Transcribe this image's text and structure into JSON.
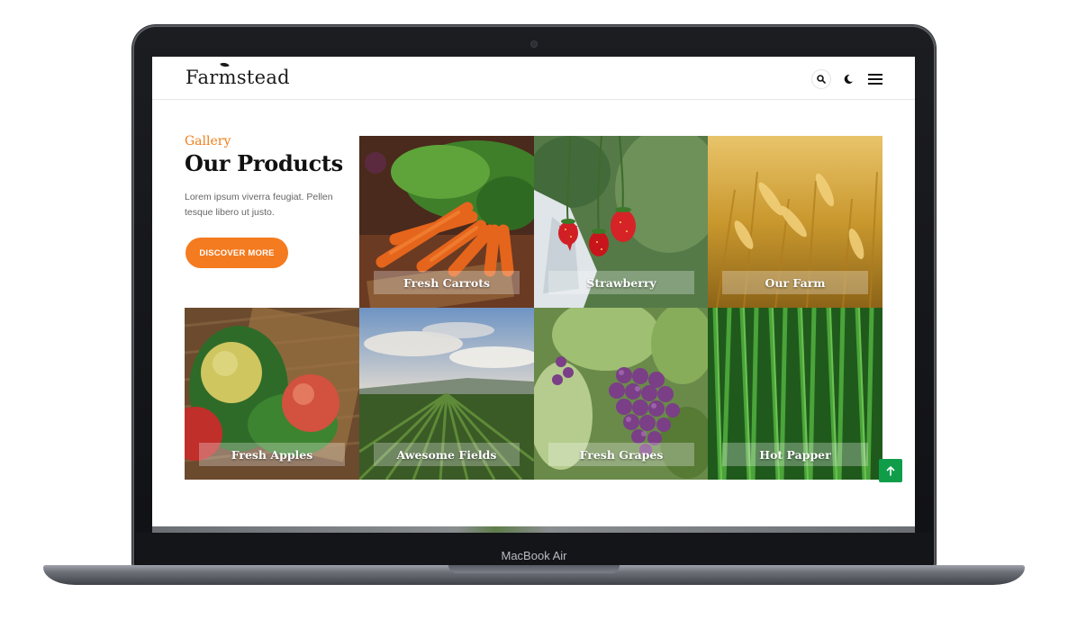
{
  "device": {
    "label": "MacBook Air"
  },
  "header": {
    "logo": "Farmstead",
    "search_icon": "search-icon",
    "theme_icon": "moon-icon",
    "menu_icon": "hamburger-menu-icon"
  },
  "intro": {
    "eyebrow": "Gallery",
    "title": "Our Products",
    "text": "Lorem ipsum viverra feugiat. Pellen tesque libero ut justo.",
    "cta_label": "DISCOVER MORE"
  },
  "gallery": [
    {
      "label": "Fresh Carrots"
    },
    {
      "label": "Strawberry"
    },
    {
      "label": "Our Farm"
    },
    {
      "label": "Fresh Apples"
    },
    {
      "label": "Awesome Fields"
    },
    {
      "label": "Fresh Grapes"
    },
    {
      "label": "Hot Papper"
    }
  ],
  "scroll_top": {
    "icon": "arrow-up-icon"
  },
  "colors": {
    "accent": "#f47b20",
    "eyebrow": "#f07e1a",
    "scroll_top": "#0f9d4a"
  }
}
